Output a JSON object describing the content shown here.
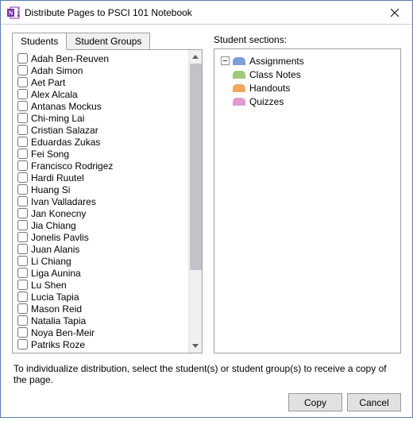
{
  "titlebar": {
    "title": "Distribute Pages to PSCI 101 Notebook"
  },
  "tabs": {
    "students": "Students",
    "student_groups": "Student Groups"
  },
  "students": [
    "Adah Ben-Reuven",
    "Adah Simon",
    "Aet Part",
    "Alex Alcala",
    "Antanas Mockus",
    "Chi-ming Lai",
    "Cristian Salazar",
    "Eduardas Zukas",
    "Fei Song",
    "Francisco Rodrigez",
    "Hardi Ruutel",
    "Huang Si",
    "Ivan Valladares",
    "Jan Konecny",
    "Jia Chiang",
    "Jonelis Pavlis",
    "Juan Alanis",
    "Li Chiang",
    "Liga Aunina",
    "Lu Shen",
    "Lucia Tapia",
    "Mason Reid",
    "Natalia Tapia",
    "Noya Ben-Meir",
    "Patriks Roze"
  ],
  "sections_label": "Student sections:",
  "sections": [
    {
      "name": "Assignments",
      "color": "#7c9fd6"
    },
    {
      "name": "Class Notes",
      "color": "#9fc978"
    },
    {
      "name": "Handouts",
      "color": "#f2a85f"
    },
    {
      "name": "Quizzes",
      "color": "#e39acb"
    }
  ],
  "hint": "To individualize distribution, select the student(s) or student group(s) to receive a copy of the page.",
  "buttons": {
    "copy": "Copy",
    "cancel": "Cancel"
  }
}
